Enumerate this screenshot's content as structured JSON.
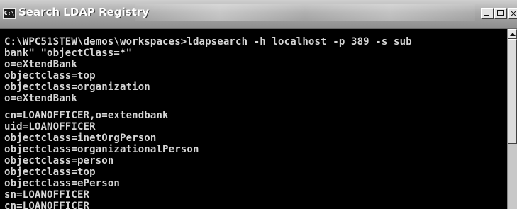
{
  "window": {
    "title": "Search LDAP Registry",
    "icon_label": "C:\\",
    "buttons": {
      "minimize": "minimize-icon",
      "maximize": "maximize-icon",
      "close_glyph": "×"
    }
  },
  "terminal": {
    "block1": [
      "C:\\WPC51STEW\\demos\\workspaces>ldapsearch -h localhost -p 389 -s sub",
      "bank\" \"objectClass=*\"",
      "o=eXtendBank",
      "objectclass=top",
      "objectclass=organization",
      "o=eXtendBank"
    ],
    "block2": [
      "cn=LOANOFFICER,o=extendbank",
      "uid=LOANOFFICER",
      "objectclass=inetOrgPerson",
      "objectclass=organizationalPerson",
      "objectclass=person",
      "objectclass=top",
      "objectclass=ePerson",
      "sn=LOANOFFICER",
      "cn=LOANOFFICER"
    ]
  },
  "colors": {
    "terminal_bg": "#000000",
    "terminal_fg": "#d6d6d6",
    "titlebar": "#9a9a9a"
  }
}
